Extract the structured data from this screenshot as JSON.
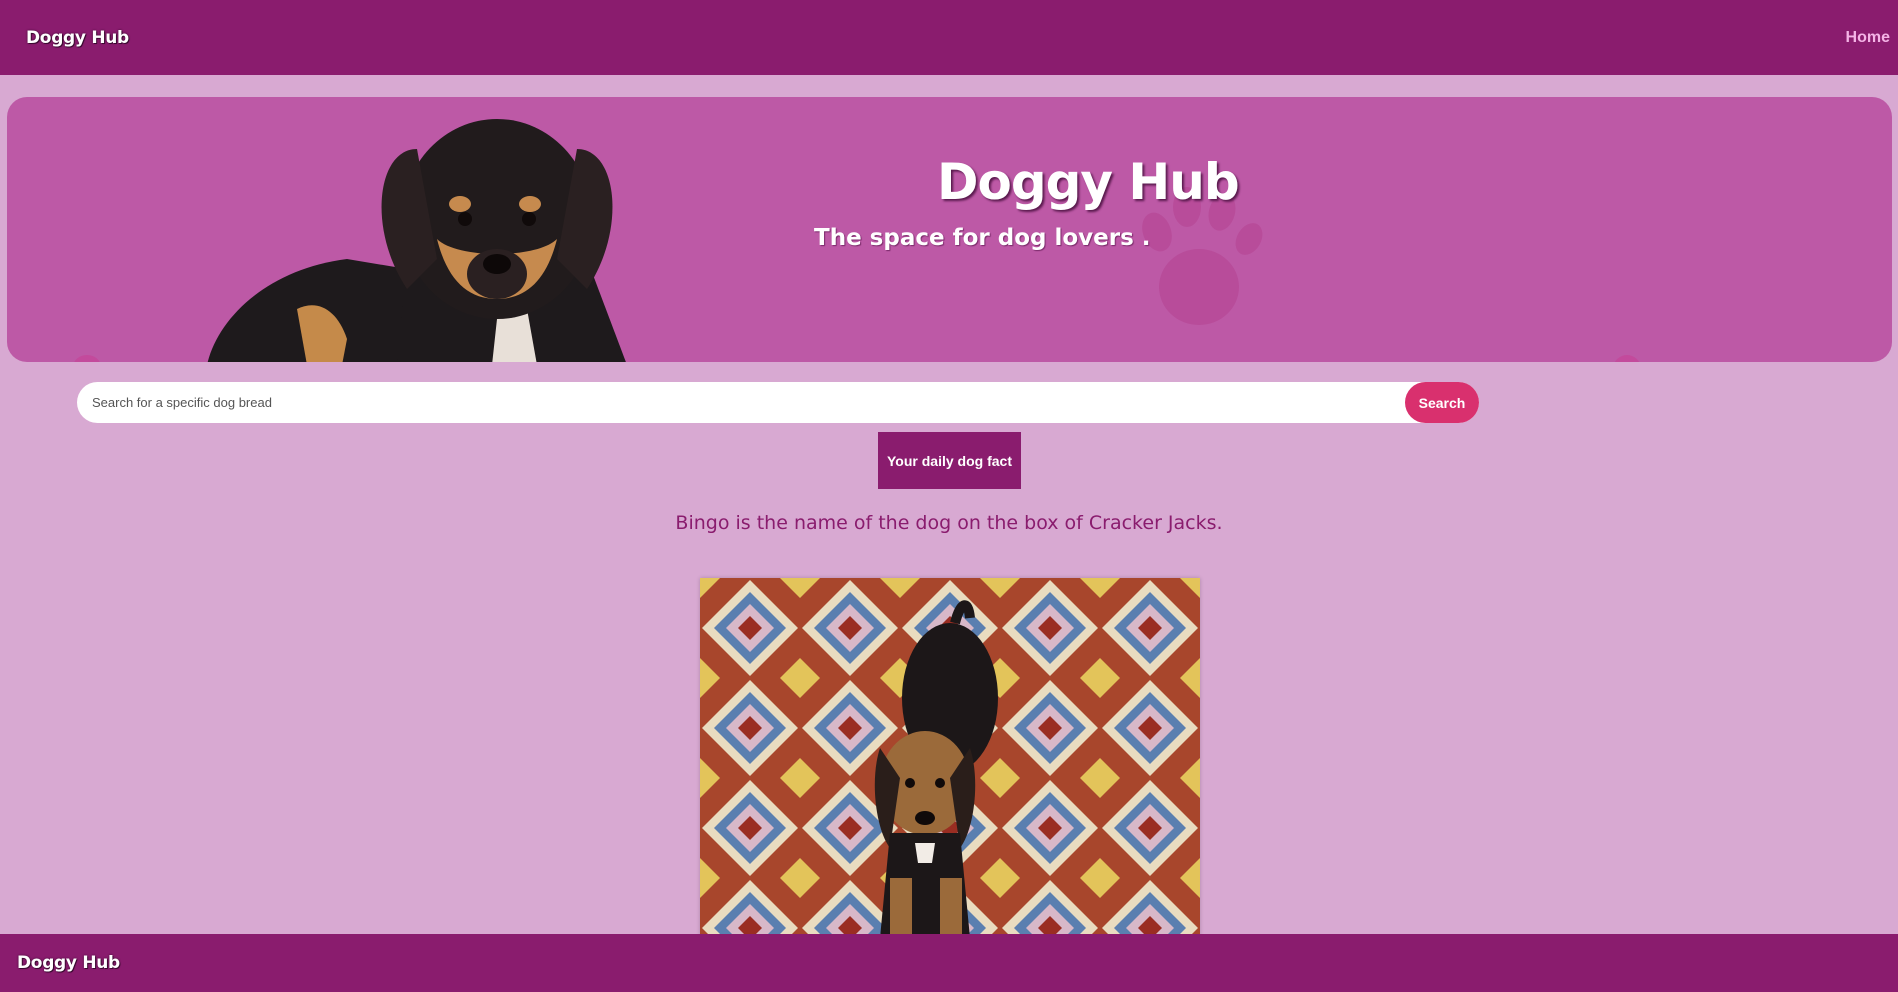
{
  "navbar": {
    "brand": "Doggy Hub",
    "home_link": "Home"
  },
  "hero": {
    "title": "Doggy Hub",
    "subtitle": "The space for dog lovers ."
  },
  "search": {
    "placeholder": "Search for a specific dog bread",
    "value": "",
    "button_label": "Search"
  },
  "fact": {
    "button_label": "Your daily dog fact",
    "text": "Bingo is the name of the dog on the box of Cracker Jacks."
  },
  "footer": {
    "brand": "Doggy Hub"
  },
  "colors": {
    "page_bg": "#d8a9d2",
    "nav_bg": "#8a1c6e",
    "hero_bg": "#bd59a6",
    "accent": "#d9306e",
    "link": "#f4b3e6"
  },
  "icons": [
    "paw-icon"
  ]
}
